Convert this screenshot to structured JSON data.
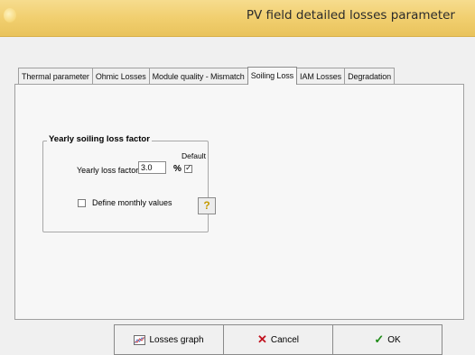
{
  "window": {
    "title": "PV field detailed losses parameter"
  },
  "tabs": [
    {
      "label": "Thermal parameter"
    },
    {
      "label": "Ohmic Losses"
    },
    {
      "label": "Module quality - Mismatch"
    },
    {
      "label": "Soiling Loss"
    },
    {
      "label": "IAM Losses"
    },
    {
      "label": "Degradation"
    }
  ],
  "soiling": {
    "group_title": "Yearly soiling loss factor",
    "default_label": "Default",
    "loss_label": "Yearly loss factor",
    "loss_value": "3.0",
    "percent": "%",
    "default_checked": true,
    "monthly_label": "Define monthly values",
    "monthly_checked": false,
    "help_label": "?"
  },
  "buttons": {
    "graph_label": "Losses graph",
    "cancel_label": "Cancel",
    "ok_label": "OK"
  },
  "icons": {
    "graph": "chart-icon",
    "cancel": "x-icon",
    "ok": "check-icon"
  }
}
